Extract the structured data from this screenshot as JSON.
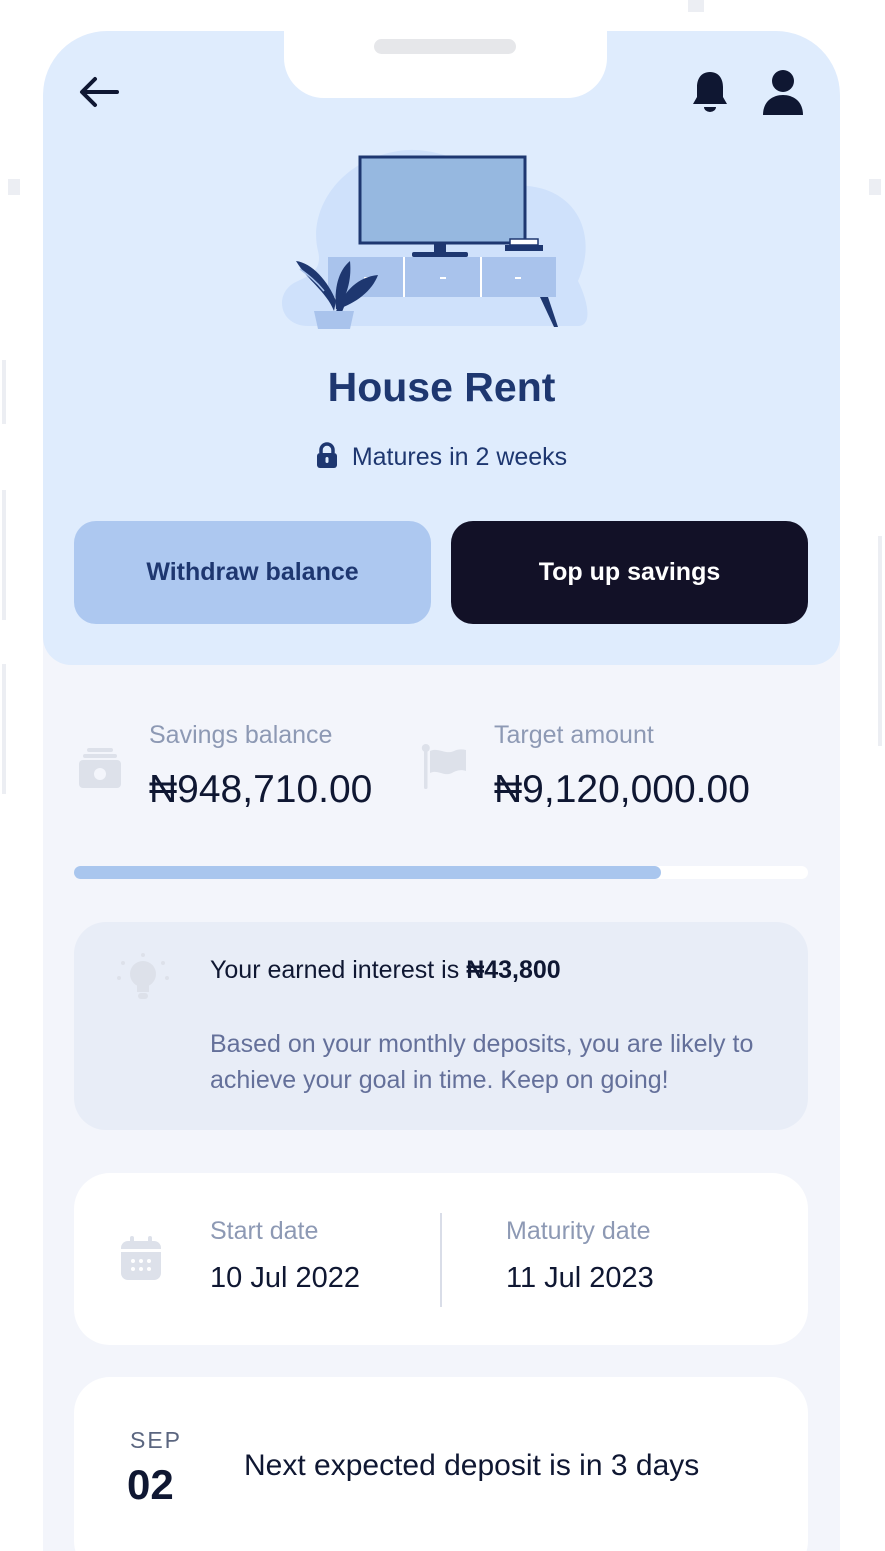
{
  "header": {
    "back_icon": "arrow-left-icon",
    "notifications_icon": "bell-icon",
    "profile_icon": "user-icon"
  },
  "goal": {
    "illustration": "tv-stand-illustration",
    "title": "House Rent",
    "status_icon": "lock-icon",
    "status": "Matures in 2 weeks"
  },
  "actions": {
    "withdraw_label": "Withdraw balance",
    "topup_label": "Top up savings"
  },
  "stats": {
    "balance_icon": "cash-icon",
    "balance_label": "Savings balance",
    "balance_value": "₦948,710.00",
    "target_icon": "flag-icon",
    "target_label": "Target amount",
    "target_value": "₦9,120,000.00"
  },
  "progress": {
    "fraction": 0.8
  },
  "interest": {
    "icon": "lightbulb-icon",
    "prefix": "Your earned interest is ",
    "amount": "₦43,800",
    "description": "Based on your monthly deposits, you are likely to achieve your goal in time. Keep on going!"
  },
  "dates": {
    "icon": "calendar-icon",
    "start_label": "Start date",
    "start_value": "10 Jul 2022",
    "maturity_label": "Maturity date",
    "maturity_value": "11 Jul 2023"
  },
  "next_deposit": {
    "month": "SEP",
    "day": "02",
    "text": "Next expected deposit is in 3 days"
  },
  "colors": {
    "hero_bg": "#dfecfd",
    "accent_dark": "#121127",
    "accent_light": "#adc8f0",
    "title": "#1e3770"
  }
}
